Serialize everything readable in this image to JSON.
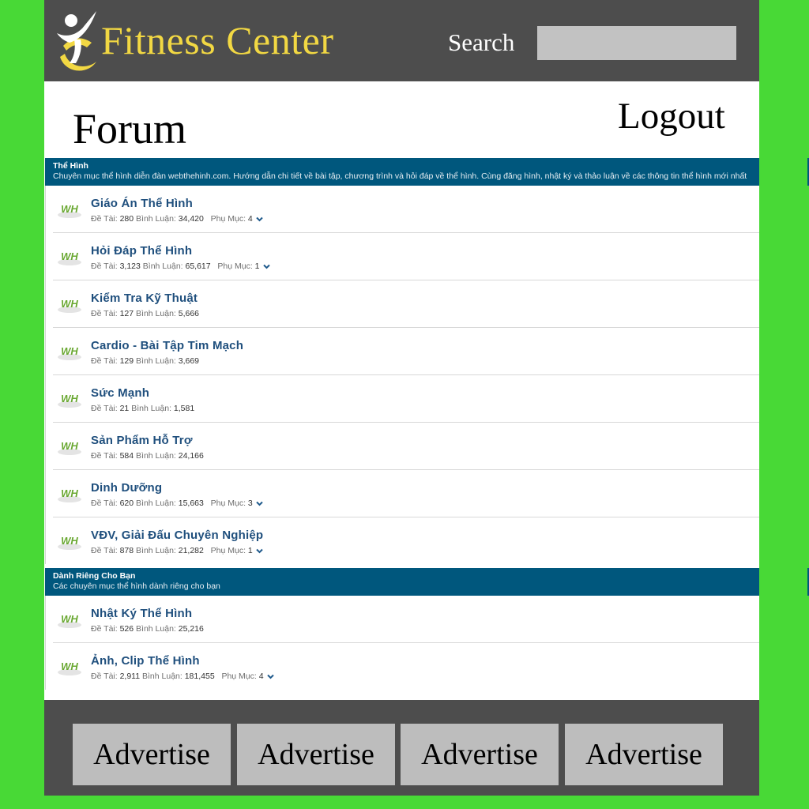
{
  "header": {
    "site_title": "Fitness Center",
    "search_label": "Search",
    "search_value": ""
  },
  "forum_bar": {
    "title": "Forum",
    "logout_label": "Logout"
  },
  "sections": [
    {
      "name": "Thể Hình",
      "description": "Chuyên mục thể hình diễn đàn webthehinh.com. Hướng dẫn chi tiết về bài tập, chương trình và hỏi đáp về thể hình. Cùng đăng hình, nhật ký và thảo luận về các thông tin thể hình mới nhất",
      "forums": [
        {
          "name": "Giáo Án Thể Hình",
          "topics_label": "Đề Tài:",
          "topics": "280",
          "posts_label": "Bình Luận:",
          "posts": "34,420",
          "sub_label": "Phụ Mục:",
          "sub": "4"
        },
        {
          "name": "Hỏi Đáp Thể Hình",
          "topics_label": "Đề Tài:",
          "topics": "3,123",
          "posts_label": "Bình Luận:",
          "posts": "65,617",
          "sub_label": "Phụ Mục:",
          "sub": "1"
        },
        {
          "name": "Kiểm Tra Kỹ Thuật",
          "topics_label": "Đề Tài:",
          "topics": "127",
          "posts_label": "Bình Luận:",
          "posts": "5,666"
        },
        {
          "name": "Cardio - Bài Tập Tim Mạch",
          "topics_label": "Đề Tài:",
          "topics": "129",
          "posts_label": "Bình Luận:",
          "posts": "3,669"
        },
        {
          "name": "Sức Mạnh",
          "topics_label": "Đề Tài:",
          "topics": "21",
          "posts_label": "Bình Luận:",
          "posts": "1,581"
        },
        {
          "name": "Sản Phẩm Hỗ Trợ",
          "topics_label": "Đề Tài:",
          "topics": "584",
          "posts_label": "Bình Luận:",
          "posts": "24,166"
        },
        {
          "name": "Dinh Dưỡng",
          "topics_label": "Đề Tài:",
          "topics": "620",
          "posts_label": "Bình Luận:",
          "posts": "15,663",
          "sub_label": "Phụ Mục:",
          "sub": "3"
        },
        {
          "name": "VĐV, Giải Đấu Chuyên Nghiệp",
          "topics_label": "Đề Tài:",
          "topics": "878",
          "posts_label": "Bình Luận:",
          "posts": "21,282",
          "sub_label": "Phụ Mục:",
          "sub": "1"
        }
      ]
    },
    {
      "name": "Dành Riêng Cho Bạn",
      "description": "Các chuyên mục thể hình dành riêng cho bạn",
      "forums": [
        {
          "name": "Nhật Ký Thể Hình",
          "topics_label": "Đề Tài:",
          "topics": "526",
          "posts_label": "Bình Luận:",
          "posts": "25,216"
        },
        {
          "name": "Ảnh, Clip Thể Hình",
          "topics_label": "Đề Tài:",
          "topics": "2,911",
          "posts_label": "Bình Luận:",
          "posts": "181,455",
          "sub_label": "Phụ Mục:",
          "sub": "4"
        }
      ]
    }
  ],
  "forum_icon_text": "WH",
  "footer": {
    "ads": [
      "Advertise",
      "Advertise",
      "Advertise",
      "Advertise"
    ]
  },
  "icons": {
    "logo": "runner-logo-icon",
    "forum": "forum-wh-icon",
    "expand": "chevron-down-icon"
  },
  "colors": {
    "background": "#48d936",
    "header": "#4d4d4d",
    "title": "#f2d843",
    "section_head": "#00577d",
    "forum_link": "#1f4f7d"
  }
}
